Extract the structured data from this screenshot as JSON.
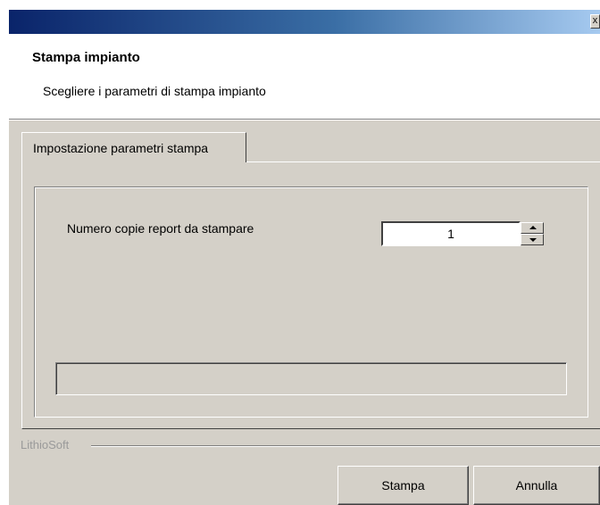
{
  "titlebar": {
    "close_glyph": "x"
  },
  "header": {
    "title": "Stampa impianto",
    "subtitle": "Scegliere i parametri di stampa impianto"
  },
  "tabs": [
    {
      "label": "Impostazione parametri stampa",
      "selected": true
    }
  ],
  "form": {
    "copies_label": "Numero copie report da stampare",
    "copies_value": "1"
  },
  "progress": {
    "value": 0
  },
  "footer": {
    "brand": "LithioSoft",
    "print_label": "Stampa",
    "cancel_label": "Annulla"
  },
  "colors": {
    "dialog_face": "#d4d0c8",
    "titlebar_start": "#0a246a",
    "titlebar_end": "#a6caf0"
  }
}
